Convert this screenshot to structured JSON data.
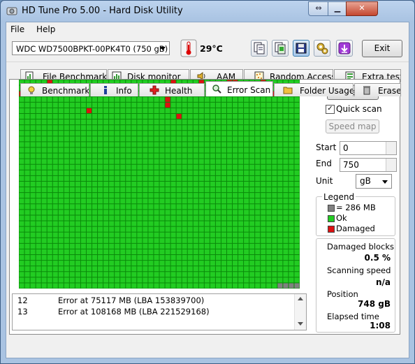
{
  "window": {
    "title": "HD Tune Pro 5.00 - Hard Disk Utility"
  },
  "menu": [
    {
      "label": "File"
    },
    {
      "label": "Help"
    }
  ],
  "toolbar": {
    "drive": "WDC WD7500BPKT-00PK4T0   (750 gB)",
    "temperature": "29°C",
    "exit_label": "Exit",
    "icons": [
      "copy-info-icon",
      "copy-screenshot-icon",
      "save-icon",
      "options-icon",
      "download-icon"
    ]
  },
  "tabs_top": [
    {
      "label": "File Benchmark",
      "icon": "file-benchmark-icon"
    },
    {
      "label": "Disk monitor",
      "icon": "disk-monitor-icon"
    },
    {
      "label": "AAM",
      "icon": "speaker-icon"
    },
    {
      "label": "Random Access",
      "icon": "random-access-icon"
    },
    {
      "label": "Extra tests",
      "icon": "extra-tests-icon"
    }
  ],
  "tabs_bottom": [
    {
      "label": "Benchmark",
      "icon": "bulb-icon"
    },
    {
      "label": "Info",
      "icon": "info-icon"
    },
    {
      "label": "Health",
      "icon": "health-cross-icon"
    },
    {
      "label": "Error Scan",
      "icon": "magnifier-icon",
      "active": true
    },
    {
      "label": "Folder Usage",
      "icon": "folder-icon"
    },
    {
      "label": "Erase",
      "icon": "trash-icon"
    }
  ],
  "scan_grid": {
    "columns": 50,
    "rows": 37,
    "ok_color": "#22cc22",
    "damaged_color": "#dd1111",
    "unscanned_color": "#808080",
    "damaged_blocks": [
      [
        0,
        5
      ],
      [
        0,
        27
      ],
      [
        0,
        32
      ],
      [
        0,
        37
      ],
      [
        0,
        38
      ],
      [
        0,
        43
      ],
      [
        1,
        37
      ],
      [
        1,
        43
      ],
      [
        2,
        0
      ],
      [
        2,
        1
      ],
      [
        2,
        2
      ],
      [
        2,
        15
      ],
      [
        2,
        35
      ],
      [
        2,
        45
      ],
      [
        3,
        26
      ],
      [
        4,
        26
      ],
      [
        5,
        12
      ],
      [
        6,
        28
      ]
    ],
    "unscanned_tail": 4
  },
  "log": [
    {
      "index": "12",
      "message": "Error at 75117 MB (LBA 153839700)"
    },
    {
      "index": "13",
      "message": "Error at 108168 MB (LBA 221529168)"
    }
  ],
  "controls": {
    "start_label": "Start",
    "quick_scan_label": "Quick scan",
    "quick_scan_checked": true,
    "speed_map_label": "Speed map",
    "start_field_label": "Start",
    "start_value": "0",
    "end_field_label": "End",
    "end_value": "750",
    "unit_label": "Unit",
    "unit_value": "gB"
  },
  "legend": {
    "title": "Legend",
    "items": [
      {
        "label": "= 286 MB",
        "color": "#808080"
      },
      {
        "label": "Ok",
        "color": "#22cc22"
      },
      {
        "label": "Damaged",
        "color": "#dd1111"
      }
    ]
  },
  "stats": {
    "damaged_label": "Damaged blocks",
    "damaged_value": "0.5 %",
    "speed_label": "Scanning speed",
    "speed_value": "n/a",
    "position_label": "Position",
    "position_value": "748 gB",
    "elapsed_label": "Elapsed time",
    "elapsed_value": "1:08"
  }
}
